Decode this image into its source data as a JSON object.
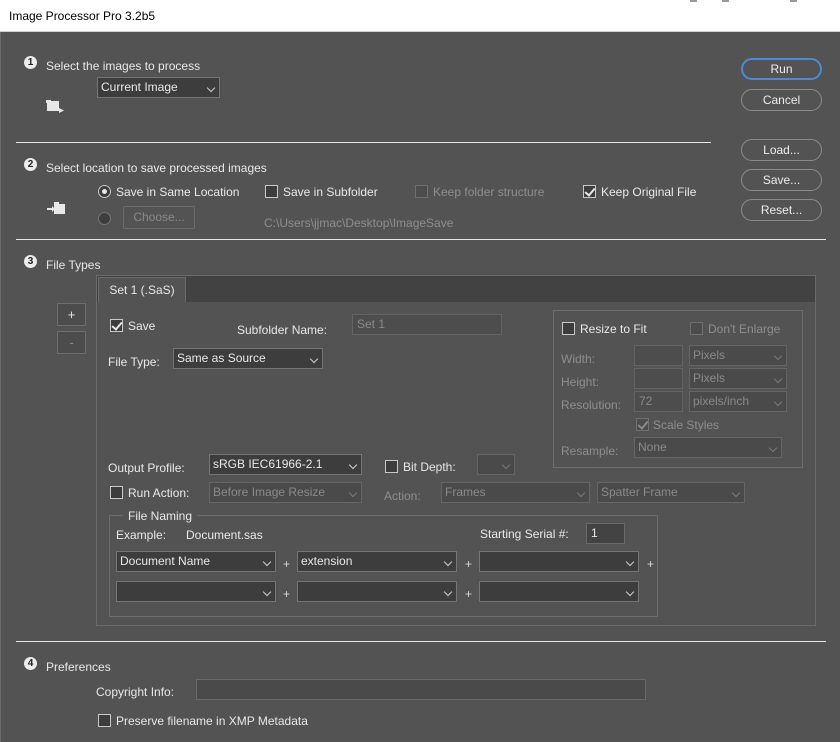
{
  "window": {
    "title": "Image Processor Pro 3.2b5"
  },
  "buttons": {
    "run": "Run",
    "cancel": "Cancel",
    "load": "Load...",
    "save": "Save...",
    "reset": "Reset..."
  },
  "section1": {
    "number": "1",
    "label": "Select the images to process",
    "source_select": "Current Image"
  },
  "section2": {
    "number": "2",
    "label": "Select location to save processed images",
    "same_location": "Save in Same Location",
    "subfolder": "Save in Subfolder",
    "keep_structure": "Keep folder structure",
    "keep_original": "Keep Original File",
    "choose_button": "Choose...",
    "path": "C:\\Users\\jjmac\\Desktop\\ImageSave"
  },
  "section3": {
    "number": "3",
    "label": "File Types",
    "add_button": "+",
    "remove_button": "-",
    "tab": "Set 1 (.SaS)",
    "save_label": "Save",
    "subfolder_name_label": "Subfolder Name:",
    "subfolder_name_value": "Set 1",
    "file_type_label": "File Type:",
    "file_type_value": "Same as Source",
    "resize": {
      "resize_to_fit": "Resize to Fit",
      "dont_enlarge": "Don't Enlarge",
      "width_label": "Width:",
      "height_label": "Height:",
      "resolution_label": "Resolution:",
      "resolution_value": "72",
      "width_unit": "Pixels",
      "height_unit": "Pixels",
      "resolution_unit": "pixels/inch",
      "scale_styles": "Scale Styles",
      "resample_label": "Resample:",
      "resample_value": "None"
    },
    "output_profile_label": "Output Profile:",
    "output_profile_value": "sRGB IEC61966-2.1",
    "bit_depth_label": "Bit Depth:",
    "run_action_label": "Run Action:",
    "run_action_timing": "Before Image Resize",
    "action_label": "Action:",
    "action_set": "Frames",
    "action_name": "Spatter Frame",
    "file_naming": {
      "legend": "File Naming",
      "example_label": "Example:",
      "example_value": "Document.sas",
      "serial_label": "Starting Serial #:",
      "serial_value": "1",
      "row1": [
        "Document Name",
        "extension",
        ""
      ],
      "row2": [
        "",
        "",
        ""
      ],
      "plus": "+"
    }
  },
  "section4": {
    "number": "4",
    "label": "Preferences",
    "copyright_label": "Copyright Info:",
    "copyright_value": "",
    "preserve_filename": "Preserve filename in XMP Metadata"
  }
}
